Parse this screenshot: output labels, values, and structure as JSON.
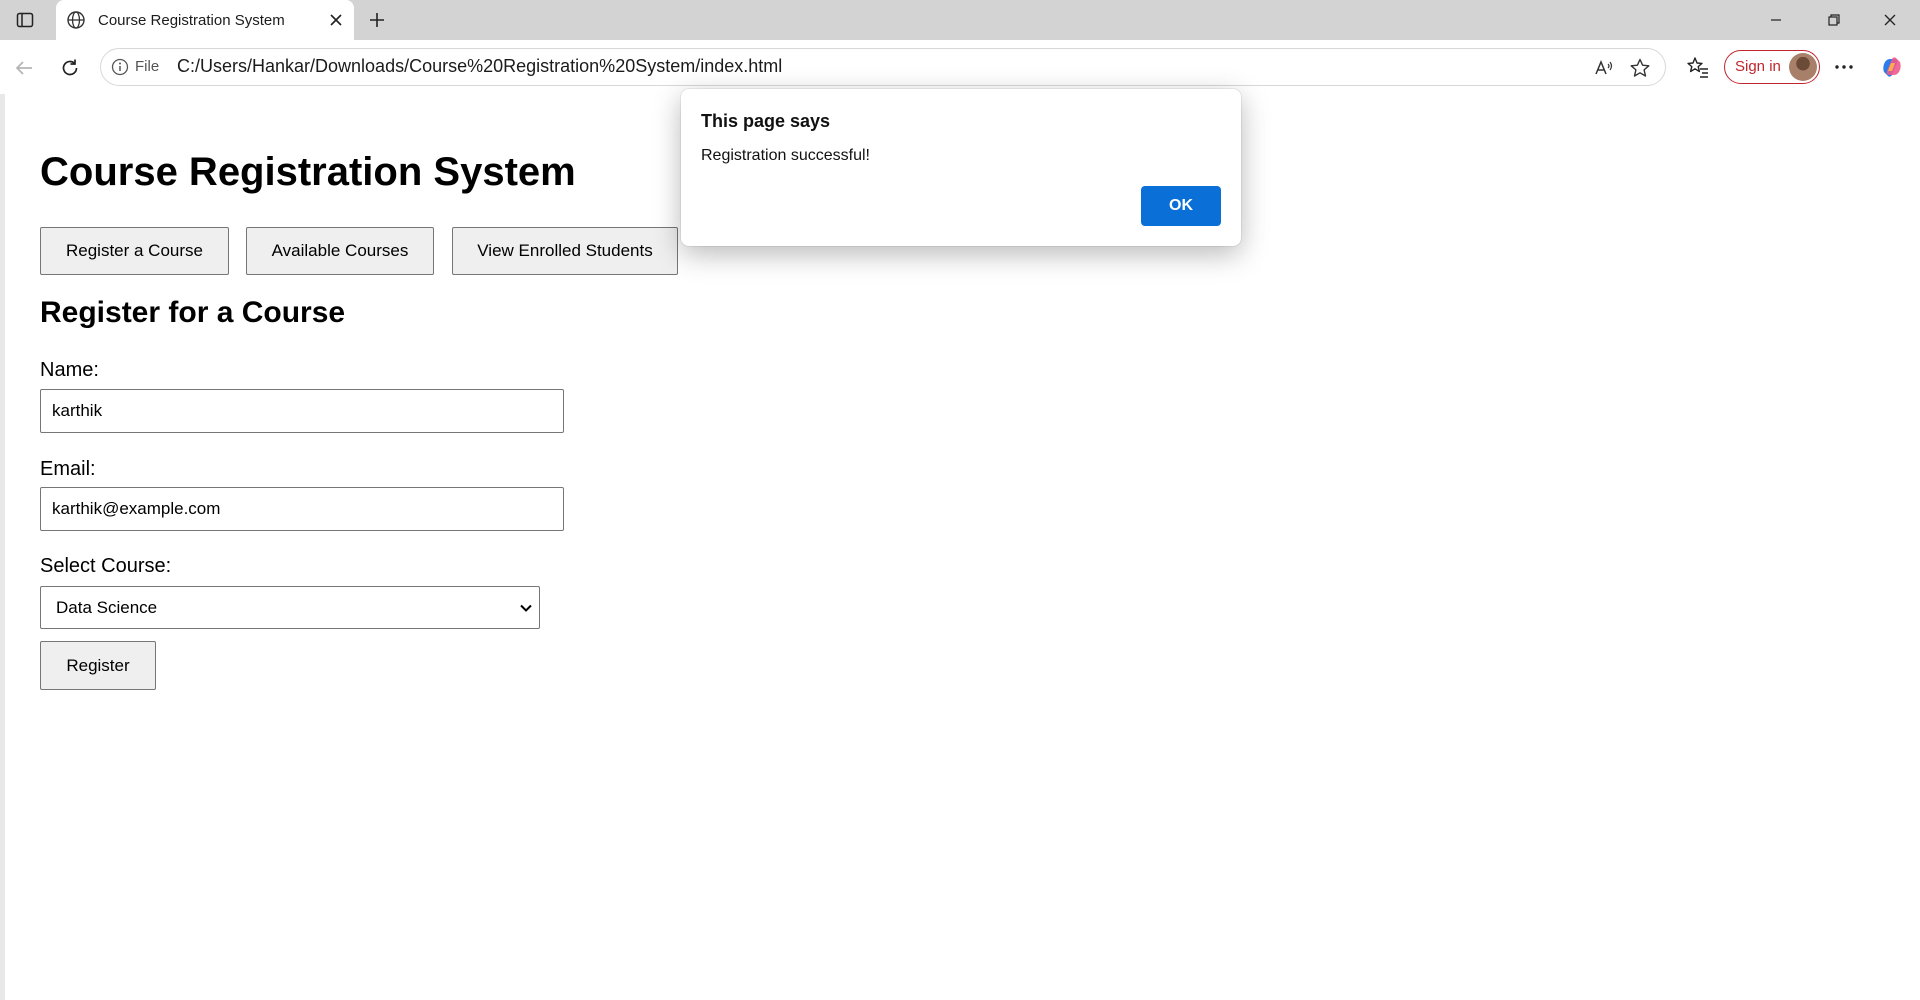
{
  "browser": {
    "tab_title": "Course Registration System",
    "omnibox_scheme_label": "File",
    "url": "C:/Users/Hankar/Downloads/Course%20Registration%20System/index.html",
    "signin_label": "Sign in",
    "accent_color": "#c0262d"
  },
  "page": {
    "title": "Course Registration System",
    "nav_buttons": [
      "Register a Course",
      "Available Courses",
      "View Enrolled Students"
    ],
    "form_heading": "Register for a Course",
    "name_label": "Name:",
    "name_value": "karthik",
    "email_label": "Email:",
    "email_value": "karthik@example.com",
    "course_label": "Select Course:",
    "course_selected": "Data Science",
    "register_label": "Register"
  },
  "dialog": {
    "title": "This page says",
    "message": "Registration successful!",
    "ok_label": "OK",
    "ok_color": "#0a6fd6"
  }
}
